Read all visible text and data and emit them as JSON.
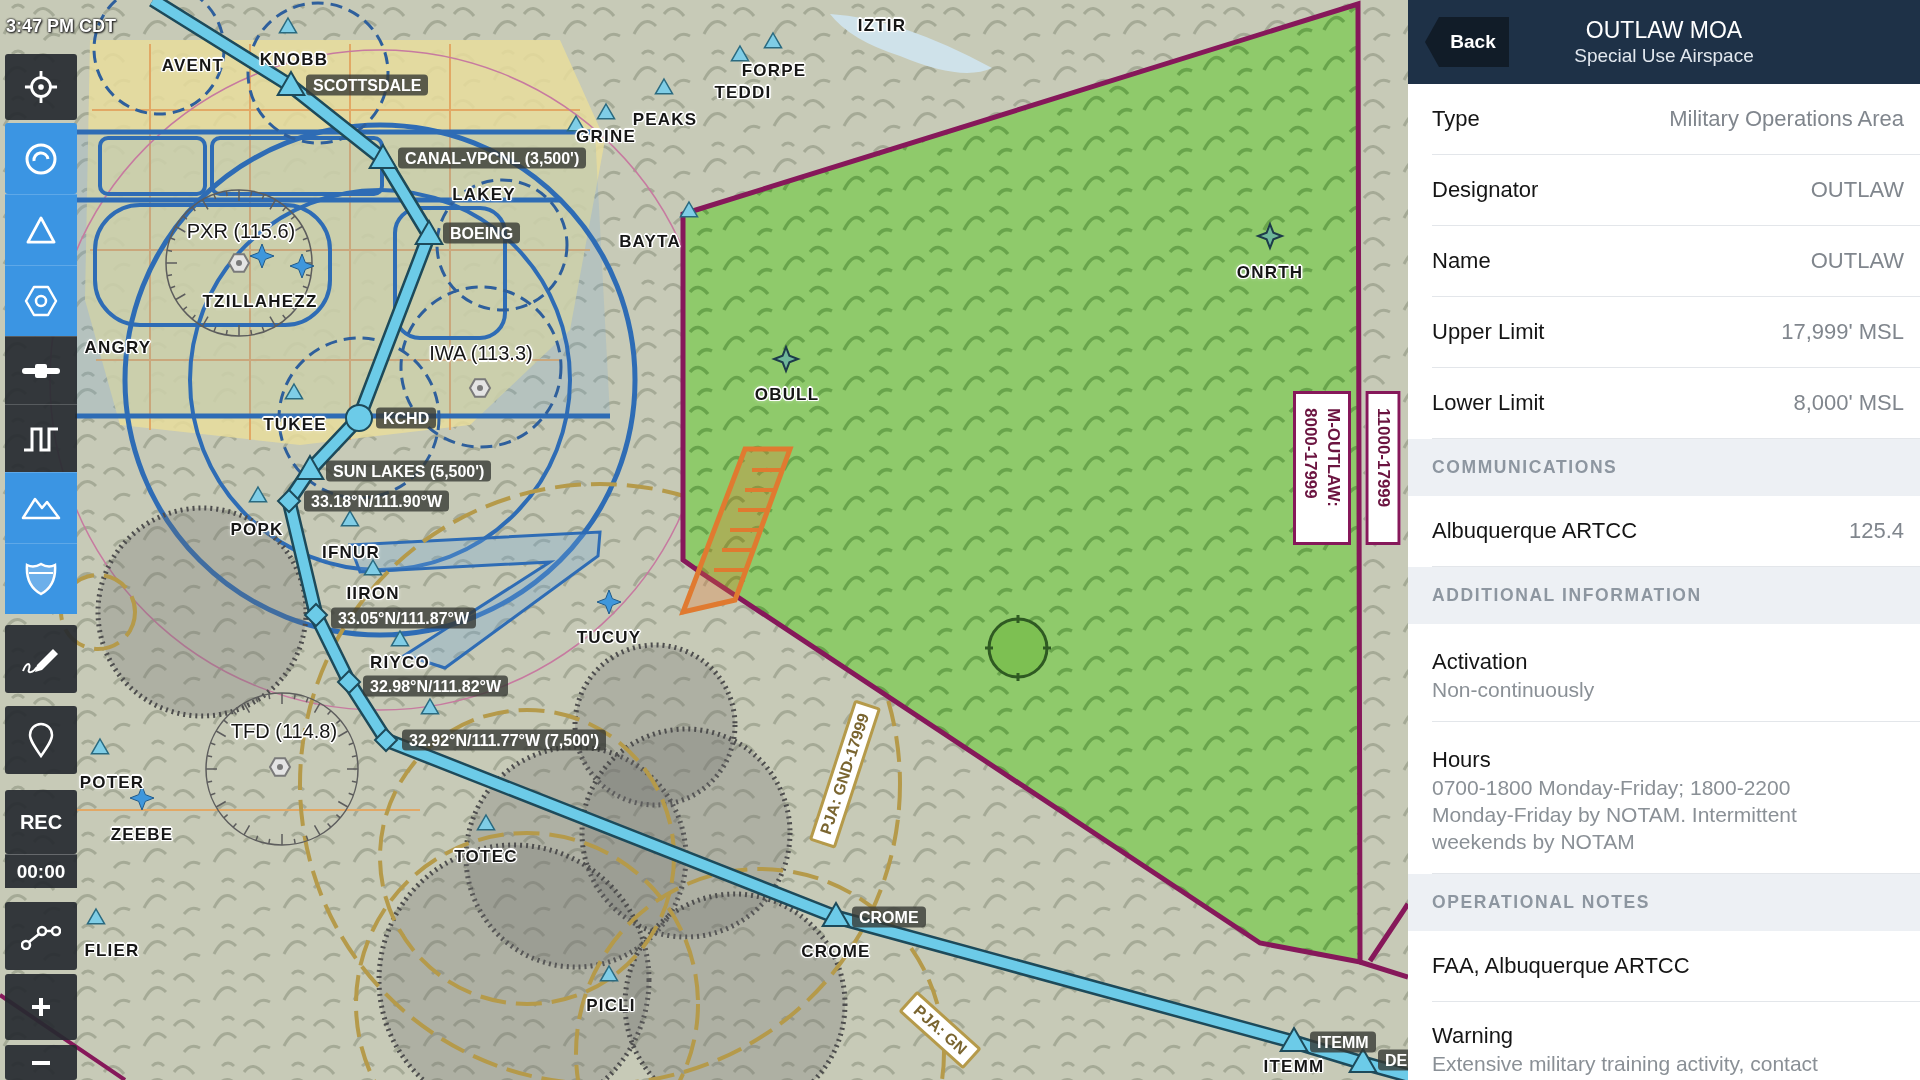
{
  "map": {
    "time": "3:47 PM CDT",
    "labels": [
      {
        "kind": "fix",
        "text": "AVENT"
      },
      {
        "kind": "fix",
        "text": "KNOBB"
      },
      {
        "kind": "route",
        "text": "SCOTTSDALE"
      },
      {
        "kind": "fix",
        "text": "IZTIR"
      },
      {
        "kind": "fix",
        "text": "FORPE"
      },
      {
        "kind": "fix",
        "text": "TEDDI"
      },
      {
        "kind": "fix",
        "text": "PEAKS"
      },
      {
        "kind": "fix",
        "text": "GRINE"
      },
      {
        "kind": "route",
        "text": "CANAL-VPCNL (3,500')"
      },
      {
        "kind": "fix",
        "text": "LAKEY"
      },
      {
        "kind": "route",
        "text": "BOEING"
      },
      {
        "kind": "fix",
        "text": "BAYTA"
      },
      {
        "kind": "navaid",
        "text": "PXR (115.6)"
      },
      {
        "kind": "fix",
        "text": "TZILLAHEZZ"
      },
      {
        "kind": "fix",
        "text": "ONRTH"
      },
      {
        "kind": "fix",
        "text": "ANGRY"
      },
      {
        "kind": "navaid",
        "text": "IWA (113.3)"
      },
      {
        "kind": "fix",
        "text": "OBULL"
      },
      {
        "kind": "route",
        "text": "KCHD"
      },
      {
        "kind": "fix",
        "text": "TUKEE"
      },
      {
        "kind": "route",
        "text": "SUN LAKES (5,500')"
      },
      {
        "kind": "route",
        "text": "33.18°N/111.90°W"
      },
      {
        "kind": "fix",
        "text": "POPK"
      },
      {
        "kind": "fix",
        "text": "IFNUR"
      },
      {
        "kind": "fix",
        "text": "IIRON"
      },
      {
        "kind": "route",
        "text": "33.05°N/111.87°W"
      },
      {
        "kind": "fix",
        "text": "TUCUY"
      },
      {
        "kind": "fix",
        "text": "RIYCO"
      },
      {
        "kind": "route",
        "text": "32.98°N/111.82°W"
      },
      {
        "kind": "navaid",
        "text": "TFD (114.8)"
      },
      {
        "kind": "route",
        "text": "32.92°N/111.77°W (7,500')"
      },
      {
        "kind": "airspace",
        "lines": [
          "M-OUTLAW:",
          "8000-17999"
        ]
      },
      {
        "kind": "airspace",
        "lines": [
          "11000-17999"
        ]
      },
      {
        "kind": "pja",
        "text": "PJA: GND-17999"
      },
      {
        "kind": "fix",
        "text": "POTER"
      },
      {
        "kind": "fix",
        "text": "ZEEBE"
      },
      {
        "kind": "fix",
        "text": "TOTEC"
      },
      {
        "kind": "route",
        "text": "CROME"
      },
      {
        "kind": "fix",
        "text": "CROME"
      },
      {
        "kind": "fix",
        "text": "FLIER"
      },
      {
        "kind": "fix",
        "text": "PICLI"
      },
      {
        "kind": "pja",
        "text": "PJA: GN"
      },
      {
        "kind": "route",
        "text": "ITEMM"
      },
      {
        "kind": "route",
        "text": "DE"
      },
      {
        "kind": "fix",
        "text": "ITEMM"
      }
    ]
  },
  "toolbar": {
    "buttons": [
      {
        "kind": "icon",
        "on": false
      },
      {
        "kind": "icon",
        "on": true
      },
      {
        "kind": "icon",
        "on": true
      },
      {
        "kind": "icon",
        "on": true
      },
      {
        "kind": "icon",
        "on": false
      },
      {
        "kind": "icon",
        "on": false
      },
      {
        "kind": "icon",
        "on": true
      },
      {
        "kind": "icon",
        "on": true
      },
      {
        "kind": "icon",
        "on": false
      },
      {
        "kind": "icon",
        "on": false
      },
      {
        "kind": "text",
        "label": "REC",
        "on": false
      },
      {
        "kind": "readout",
        "label": "00:00",
        "on": false
      },
      {
        "kind": "icon",
        "on": false
      },
      {
        "kind": "icon",
        "on": false
      },
      {
        "kind": "icon",
        "on": false
      }
    ]
  },
  "panel": {
    "back": "Back",
    "title": "OUTLAW MOA",
    "subtitle": "Special Use Airspace",
    "rows": [
      {
        "kind": "pair",
        "label": "Type",
        "value": "Military Operations Area"
      },
      {
        "kind": "pair",
        "label": "Designator",
        "value": "OUTLAW"
      },
      {
        "kind": "pair",
        "label": "Name",
        "value": "OUTLAW"
      },
      {
        "kind": "pair",
        "label": "Upper Limit",
        "value": "17,999' MSL"
      },
      {
        "kind": "pair",
        "label": "Lower Limit",
        "value": "8,000' MSL"
      },
      {
        "kind": "section",
        "label": "COMMUNICATIONS"
      },
      {
        "kind": "pair",
        "label": "Albuquerque ARTCC",
        "value": "125.4"
      },
      {
        "kind": "section",
        "label": "ADDITIONAL INFORMATION"
      },
      {
        "kind": "stacked",
        "label": "Activation",
        "value": "Non-continuously"
      },
      {
        "kind": "stacked",
        "label": "Hours",
        "value": "0700-1800 Monday-Friday; 1800-2200 Monday-Friday by NOTAM. Intermittent weekends by NOTAM"
      },
      {
        "kind": "section",
        "label": "OPERATIONAL NOTES"
      },
      {
        "kind": "single",
        "label": "FAA, Albuquerque ARTCC"
      },
      {
        "kind": "stacked",
        "label": "Warning",
        "value": "Extensive military training activity, contact"
      }
    ]
  }
}
